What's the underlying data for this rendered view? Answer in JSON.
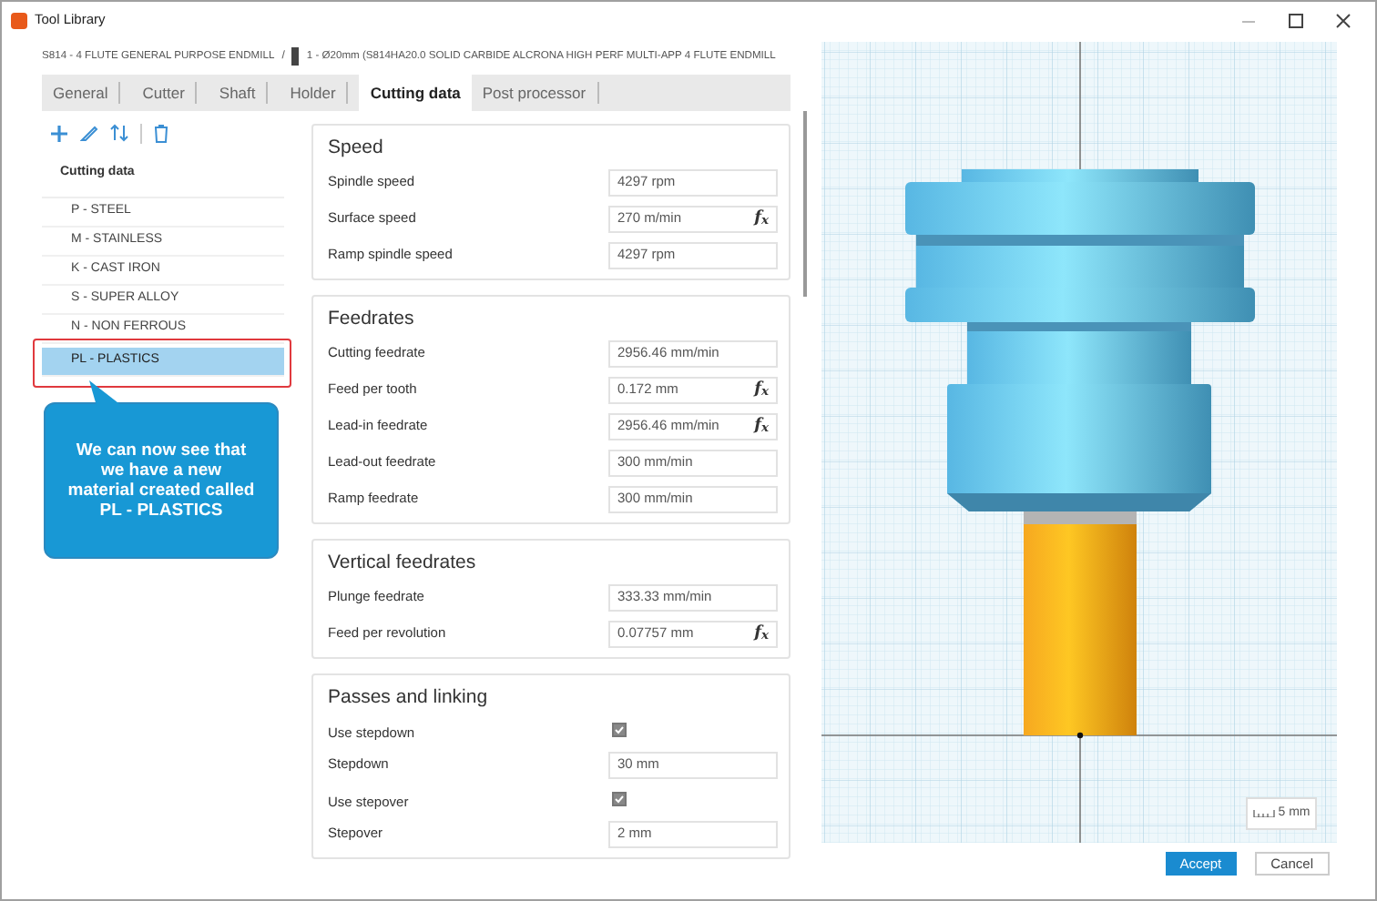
{
  "window": {
    "title": "Tool Library"
  },
  "breadcrumb": {
    "library": "S814 - 4 FLUTE GENERAL PURPOSE ENDMILL",
    "separator": "/",
    "tool": "1 - Ø20mm (S814HA20.0 SOLID CARBIDE ALCRONA HIGH PERF MULTI-APP 4 FLUTE ENDMILL"
  },
  "tabs": [
    {
      "label": "General",
      "selected": false
    },
    {
      "label": "Cutter",
      "selected": false
    },
    {
      "label": "Shaft",
      "selected": false
    },
    {
      "label": "Holder",
      "selected": false
    },
    {
      "label": "Cutting data",
      "selected": true
    },
    {
      "label": "Post processor",
      "selected": false
    }
  ],
  "materials": {
    "header": "Cutting data",
    "items": [
      {
        "label": "P - STEEL",
        "selected": false,
        "highlighted": false
      },
      {
        "label": "M - STAINLESS",
        "selected": false,
        "highlighted": false
      },
      {
        "label": "K - CAST IRON",
        "selected": false,
        "highlighted": false
      },
      {
        "label": "S - SUPER ALLOY",
        "selected": false,
        "highlighted": false
      },
      {
        "label": "N - NON FERROUS",
        "selected": false,
        "highlighted": false
      },
      {
        "label": "PL - PLASTICS",
        "selected": true,
        "highlighted": true
      }
    ]
  },
  "callout": {
    "text": "We can now see that we have a new material created called PL - PLASTICS"
  },
  "sections": [
    {
      "title": "Speed",
      "rows": [
        {
          "kind": "field",
          "label": "Spindle speed",
          "value": "4297 rpm"
        },
        {
          "kind": "field",
          "label": "Surface speed",
          "value": "270 m/min",
          "fx": "f$_{x}$"
        },
        {
          "kind": "field",
          "label": "Ramp spindle speed",
          "value": "4297 rpm"
        }
      ]
    },
    {
      "title": "Feedrates",
      "rows": [
        {
          "kind": "field",
          "label": "Cutting feedrate",
          "value": "2956.46 mm/min"
        },
        {
          "kind": "field",
          "label": "Feed per tooth",
          "value": "0.172 mm",
          "fx": "f$_{x}$"
        },
        {
          "kind": "field",
          "label": "Lead-in feedrate",
          "value": "2956.46 mm/min",
          "fx": "f$_{x}$"
        },
        {
          "kind": "field",
          "label": "Lead-out feedrate",
          "value": "300 mm/min"
        },
        {
          "kind": "field",
          "label": "Ramp feedrate",
          "value": "300 mm/min"
        }
      ]
    },
    {
      "title": "Vertical feedrates",
      "rows": [
        {
          "kind": "field",
          "label": "Plunge feedrate",
          "value": "333.33 mm/min"
        },
        {
          "kind": "field",
          "label": "Feed per revolution",
          "value": "0.07757 mm",
          "fx": "f$_{x}$"
        }
      ]
    },
    {
      "title": "Passes and linking",
      "rows": [
        {
          "kind": "checkbox",
          "label": "Use stepdown",
          "checked": true
        },
        {
          "kind": "field",
          "label": "Stepdown",
          "value": "30 mm"
        },
        {
          "kind": "checkbox",
          "label": "Use stepover",
          "checked": true
        },
        {
          "kind": "field",
          "label": "Stepover",
          "value": "2 mm"
        }
      ]
    }
  ],
  "viewer": {
    "scale_label": "5 mm"
  },
  "buttons": [
    {
      "label": "Accept",
      "primary": true
    },
    {
      "label": "Cancel",
      "primary": false
    }
  ]
}
